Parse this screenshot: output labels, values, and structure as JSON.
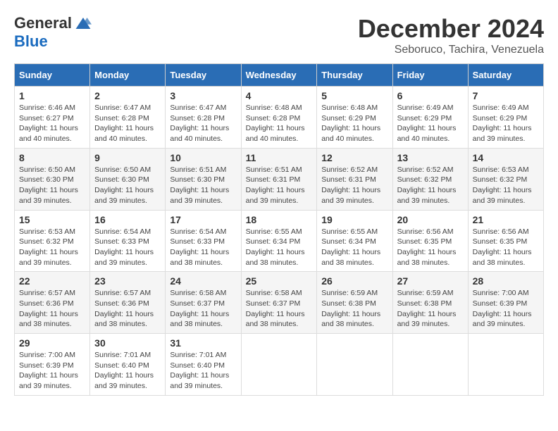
{
  "logo": {
    "general": "General",
    "blue": "Blue"
  },
  "title": {
    "month_year": "December 2024",
    "location": "Seboruco, Tachira, Venezuela"
  },
  "days_of_week": [
    "Sunday",
    "Monday",
    "Tuesday",
    "Wednesday",
    "Thursday",
    "Friday",
    "Saturday"
  ],
  "weeks": [
    [
      {
        "day": "1",
        "sunrise": "6:46 AM",
        "sunset": "6:27 PM",
        "daylight": "11 hours and 40 minutes."
      },
      {
        "day": "2",
        "sunrise": "6:47 AM",
        "sunset": "6:28 PM",
        "daylight": "11 hours and 40 minutes."
      },
      {
        "day": "3",
        "sunrise": "6:47 AM",
        "sunset": "6:28 PM",
        "daylight": "11 hours and 40 minutes."
      },
      {
        "day": "4",
        "sunrise": "6:48 AM",
        "sunset": "6:28 PM",
        "daylight": "11 hours and 40 minutes."
      },
      {
        "day": "5",
        "sunrise": "6:48 AM",
        "sunset": "6:29 PM",
        "daylight": "11 hours and 40 minutes."
      },
      {
        "day": "6",
        "sunrise": "6:49 AM",
        "sunset": "6:29 PM",
        "daylight": "11 hours and 40 minutes."
      },
      {
        "day": "7",
        "sunrise": "6:49 AM",
        "sunset": "6:29 PM",
        "daylight": "11 hours and 39 minutes."
      }
    ],
    [
      {
        "day": "8",
        "sunrise": "6:50 AM",
        "sunset": "6:30 PM",
        "daylight": "11 hours and 39 minutes."
      },
      {
        "day": "9",
        "sunrise": "6:50 AM",
        "sunset": "6:30 PM",
        "daylight": "11 hours and 39 minutes."
      },
      {
        "day": "10",
        "sunrise": "6:51 AM",
        "sunset": "6:30 PM",
        "daylight": "11 hours and 39 minutes."
      },
      {
        "day": "11",
        "sunrise": "6:51 AM",
        "sunset": "6:31 PM",
        "daylight": "11 hours and 39 minutes."
      },
      {
        "day": "12",
        "sunrise": "6:52 AM",
        "sunset": "6:31 PM",
        "daylight": "11 hours and 39 minutes."
      },
      {
        "day": "13",
        "sunrise": "6:52 AM",
        "sunset": "6:32 PM",
        "daylight": "11 hours and 39 minutes."
      },
      {
        "day": "14",
        "sunrise": "6:53 AM",
        "sunset": "6:32 PM",
        "daylight": "11 hours and 39 minutes."
      }
    ],
    [
      {
        "day": "15",
        "sunrise": "6:53 AM",
        "sunset": "6:32 PM",
        "daylight": "11 hours and 39 minutes."
      },
      {
        "day": "16",
        "sunrise": "6:54 AM",
        "sunset": "6:33 PM",
        "daylight": "11 hours and 39 minutes."
      },
      {
        "day": "17",
        "sunrise": "6:54 AM",
        "sunset": "6:33 PM",
        "daylight": "11 hours and 38 minutes."
      },
      {
        "day": "18",
        "sunrise": "6:55 AM",
        "sunset": "6:34 PM",
        "daylight": "11 hours and 38 minutes."
      },
      {
        "day": "19",
        "sunrise": "6:55 AM",
        "sunset": "6:34 PM",
        "daylight": "11 hours and 38 minutes."
      },
      {
        "day": "20",
        "sunrise": "6:56 AM",
        "sunset": "6:35 PM",
        "daylight": "11 hours and 38 minutes."
      },
      {
        "day": "21",
        "sunrise": "6:56 AM",
        "sunset": "6:35 PM",
        "daylight": "11 hours and 38 minutes."
      }
    ],
    [
      {
        "day": "22",
        "sunrise": "6:57 AM",
        "sunset": "6:36 PM",
        "daylight": "11 hours and 38 minutes."
      },
      {
        "day": "23",
        "sunrise": "6:57 AM",
        "sunset": "6:36 PM",
        "daylight": "11 hours and 38 minutes."
      },
      {
        "day": "24",
        "sunrise": "6:58 AM",
        "sunset": "6:37 PM",
        "daylight": "11 hours and 38 minutes."
      },
      {
        "day": "25",
        "sunrise": "6:58 AM",
        "sunset": "6:37 PM",
        "daylight": "11 hours and 38 minutes."
      },
      {
        "day": "26",
        "sunrise": "6:59 AM",
        "sunset": "6:38 PM",
        "daylight": "11 hours and 38 minutes."
      },
      {
        "day": "27",
        "sunrise": "6:59 AM",
        "sunset": "6:38 PM",
        "daylight": "11 hours and 39 minutes."
      },
      {
        "day": "28",
        "sunrise": "7:00 AM",
        "sunset": "6:39 PM",
        "daylight": "11 hours and 39 minutes."
      }
    ],
    [
      {
        "day": "29",
        "sunrise": "7:00 AM",
        "sunset": "6:39 PM",
        "daylight": "11 hours and 39 minutes."
      },
      {
        "day": "30",
        "sunrise": "7:01 AM",
        "sunset": "6:40 PM",
        "daylight": "11 hours and 39 minutes."
      },
      {
        "day": "31",
        "sunrise": "7:01 AM",
        "sunset": "6:40 PM",
        "daylight": "11 hours and 39 minutes."
      },
      null,
      null,
      null,
      null
    ]
  ],
  "labels": {
    "sunrise": "Sunrise:",
    "sunset": "Sunset:",
    "daylight": "Daylight:"
  }
}
